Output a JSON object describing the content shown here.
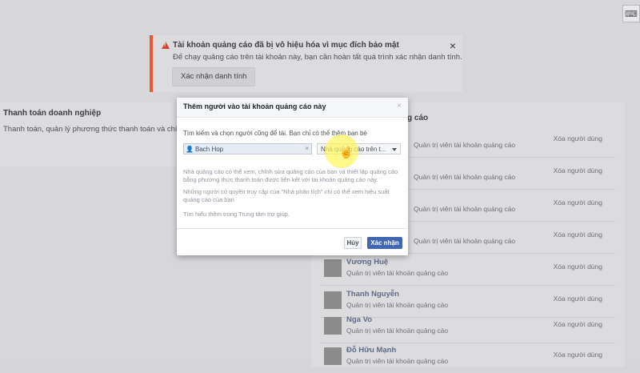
{
  "alert": {
    "title": "Tài khoản quảng cáo đã bị vô hiệu hóa vì mục đích bảo mật",
    "body": "Để chạy quảng cáo trên tài khoản này, bạn cần hoàn tất quá trình xác nhận danh tính.",
    "button": "Xác nhận danh tính",
    "close": "×",
    "accent": "#e95a2e"
  },
  "billing": {
    "title": "Thanh toán doanh nghiệp",
    "desc": "Thanh toán, quản lý phương thức thanh toán và chính"
  },
  "people": {
    "title_fragment": "g cáo",
    "remove_label": "Xóa người dùng",
    "rows": [
      {
        "name": "",
        "role": "Quản trị viên tài khoản quảng cáo"
      },
      {
        "name": "",
        "role": "Quản trị viên tài khoản quảng cáo"
      },
      {
        "name": "",
        "role": "Quản trị viên tài khoản quảng cáo"
      },
      {
        "name": "",
        "role": "Quản trị viên tài khoản quảng cáo"
      },
      {
        "name": "Vương Huệ",
        "role": "Quản trị viên tài khoản quảng cáo"
      },
      {
        "name": "Thanh Nguyễn",
        "role": "Quản trị viên tài khoản quảng cáo"
      },
      {
        "name": "Nga Vo",
        "role": "Quản trị viên tài khoản quảng cáo"
      },
      {
        "name": "Đỗ Hữu Mạnh",
        "role": "Quản trị viên tài khoản quảng cáo"
      }
    ]
  },
  "modal": {
    "title": "Thêm người vào tài khoản quảng cáo này",
    "close": "×",
    "instruction": "Tìm kiếm và chọn người cũng để tài. Bạn chỉ có thể thêm bạn bè",
    "person_value": "Bach Hop",
    "role_value": "Nhà quảng cáo trên t...",
    "desc1": "Nhà quảng cáo có thể xem, chỉnh sửa quảng cáo của bạn và thiết lập quảng cáo bằng phương thức thanh toán được liên kết với tài khoản quảng cáo này.",
    "desc2": "Những người có quyền truy cập của \"Nhà phân tích\" chỉ có thể xem hiệu suất quảng cáo của bạn",
    "help": "Tìm hiểu thêm trong Trung tâm trợ giúp.",
    "cancel": "Hủy",
    "confirm": "Xác nhận",
    "confirm_color": "#4267b2"
  }
}
